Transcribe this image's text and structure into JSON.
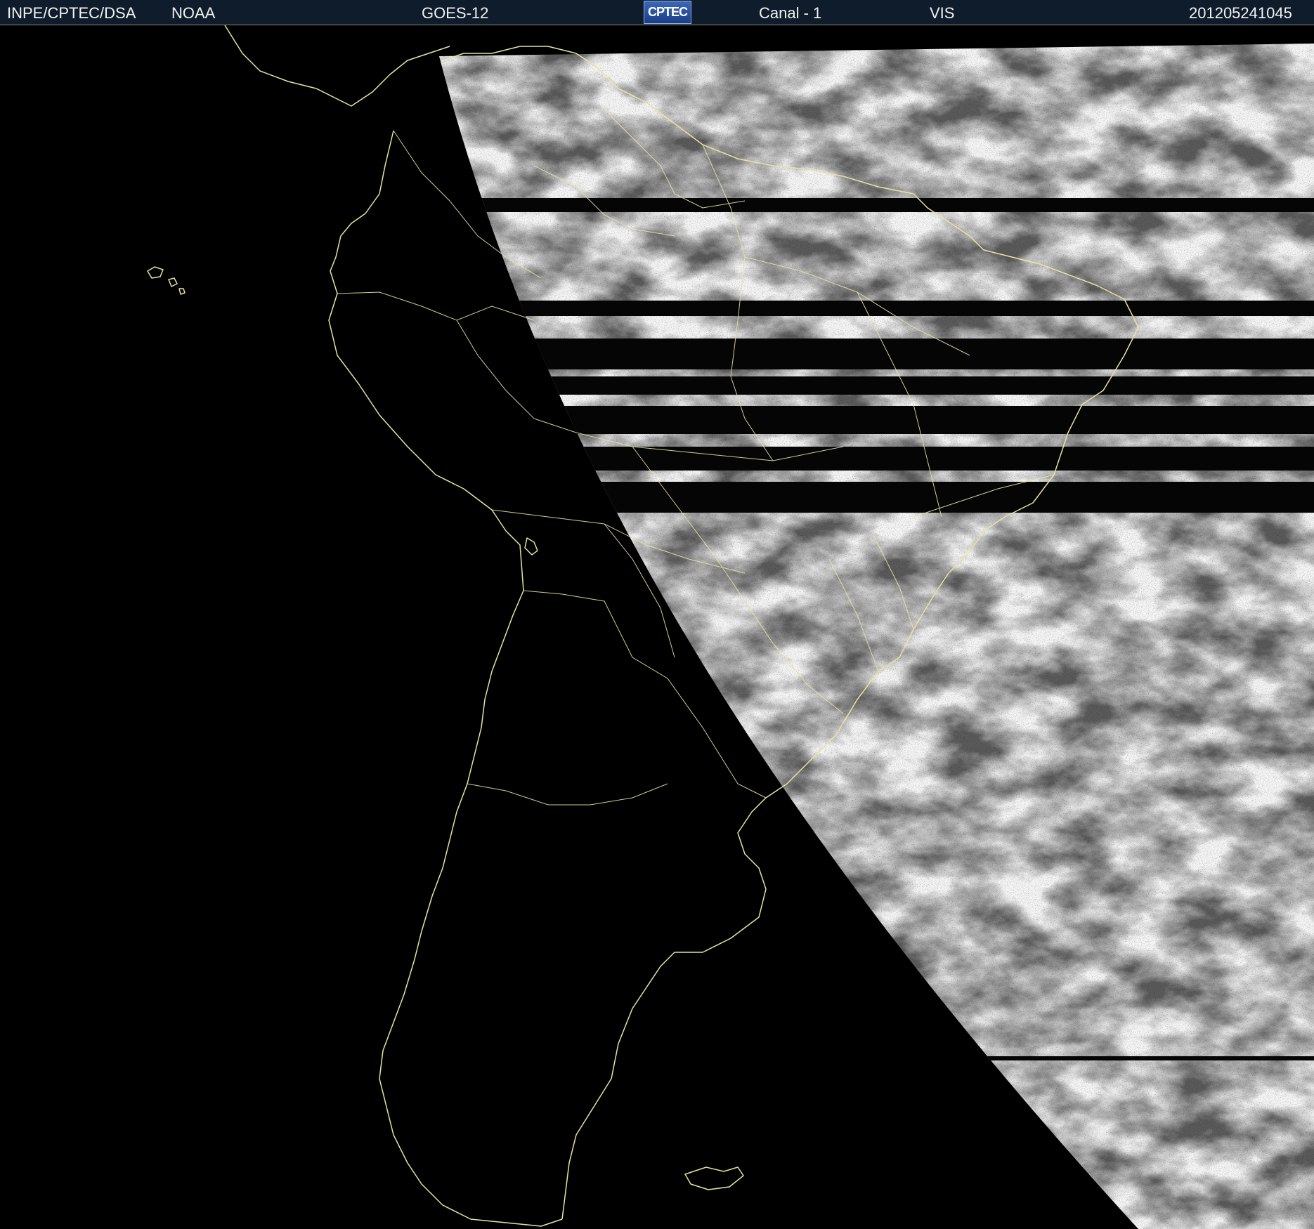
{
  "header": {
    "agency": "INPE/CPTEC/DSA",
    "operator": "NOAA",
    "satellite": "GOES-12",
    "logo_text": "CPTEC",
    "channel": "Canal - 1",
    "band": "VIS",
    "timestamp": "201205241045"
  },
  "colors": {
    "header_bg": "#0f1c2b",
    "header_text": "#f2f2f2",
    "coastline": "#e8e3a0",
    "background": "#000000"
  },
  "icons": {
    "logo": "cptec-logo"
  }
}
